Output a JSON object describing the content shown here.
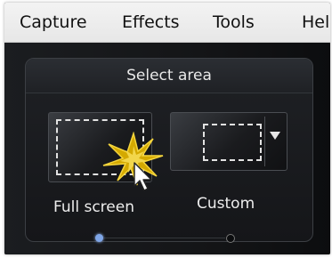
{
  "menu": {
    "items": [
      {
        "label": "Capture"
      },
      {
        "label": "Effects"
      },
      {
        "label": "Tools"
      },
      {
        "label": "Help"
      }
    ]
  },
  "panel": {
    "title": "Select area",
    "options": [
      {
        "label": "Full screen",
        "icon": "dashed-rectangle-icon"
      },
      {
        "label": "Custom",
        "icon": "dashed-rectangle-icon",
        "dropdown_icon": "dropdown-arrow-icon"
      }
    ],
    "pager": {
      "current": 1,
      "total": 2
    }
  },
  "colors": {
    "window_bg": "#141517",
    "menubar_bg": "#ececec",
    "active_dot": "#7fa6e8",
    "spark": "#e6b800"
  }
}
